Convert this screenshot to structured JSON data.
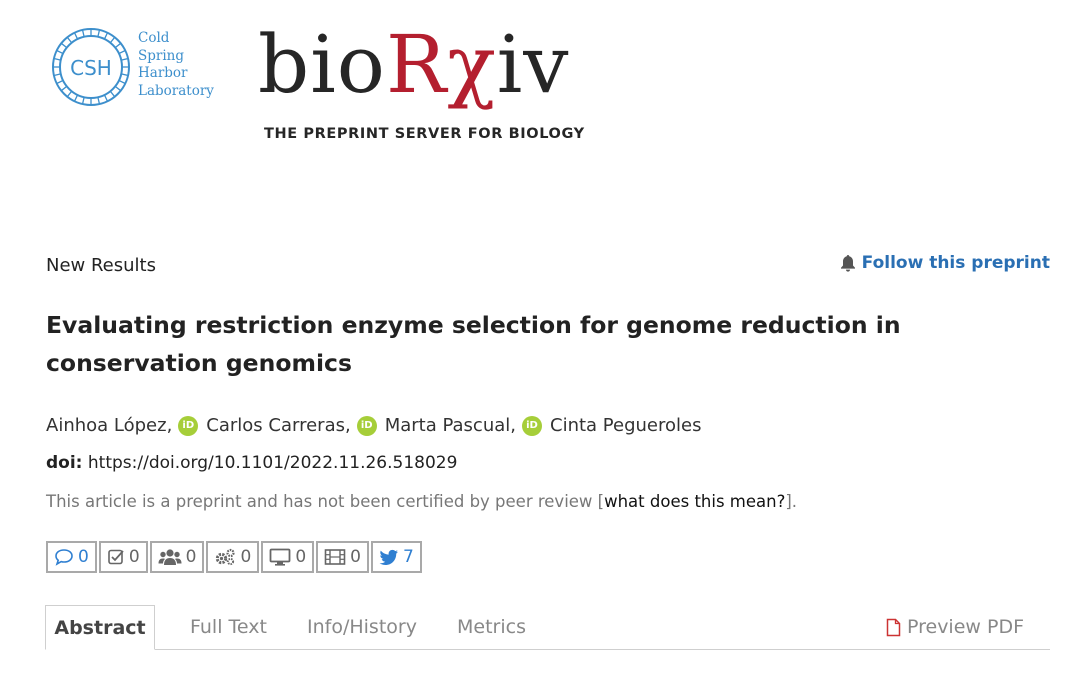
{
  "header": {
    "csh_logo": {
      "monogram": "CSH",
      "lines": [
        "Cold",
        "Spring",
        "Harbor",
        "Laboratory"
      ],
      "color": "#3d8fcc"
    },
    "biorxiv_logo": {
      "prefix": "bio",
      "rx": "Rχ",
      "suffix": "iv",
      "tagline": "THE PREPRINT SERVER FOR BIOLOGY",
      "accent": "#b41f2f"
    }
  },
  "article": {
    "type": "New Results",
    "follow_label": "Follow this preprint",
    "follow_icon": "bell-icon",
    "title": "Evaluating restriction enzyme selection for genome reduction in conservation genomics",
    "authors": [
      "Ainhoa López,",
      "Carlos Carreras,",
      "Marta Pascual,",
      "Cinta Pegueroles"
    ],
    "orcid_label": "iD",
    "doi_label": "doi:",
    "doi_value": "https://doi.org/10.1101/2022.11.26.518029",
    "peer_note_prefix": "This article is a preprint and has not been certified by peer review [",
    "peer_note_link": "what does this mean?",
    "peer_note_suffix": "]."
  },
  "metrics": [
    {
      "icon": "comment-icon",
      "count": "0"
    },
    {
      "icon": "checklist-icon",
      "count": "0"
    },
    {
      "icon": "users-icon",
      "count": "0"
    },
    {
      "icon": "gears-icon",
      "count": "0"
    },
    {
      "icon": "monitor-icon",
      "count": "0"
    },
    {
      "icon": "film-icon",
      "count": "0"
    },
    {
      "icon": "twitter-icon",
      "count": "7"
    }
  ],
  "tabs": {
    "abstract": "Abstract",
    "fulltext": "Full Text",
    "info": "Info/History",
    "metrics": "Metrics",
    "preview_pdf": "Preview PDF"
  },
  "colors": {
    "link": "#2a6fb3",
    "orcid": "#a6ce39",
    "twitter": "#2f7fd1"
  }
}
